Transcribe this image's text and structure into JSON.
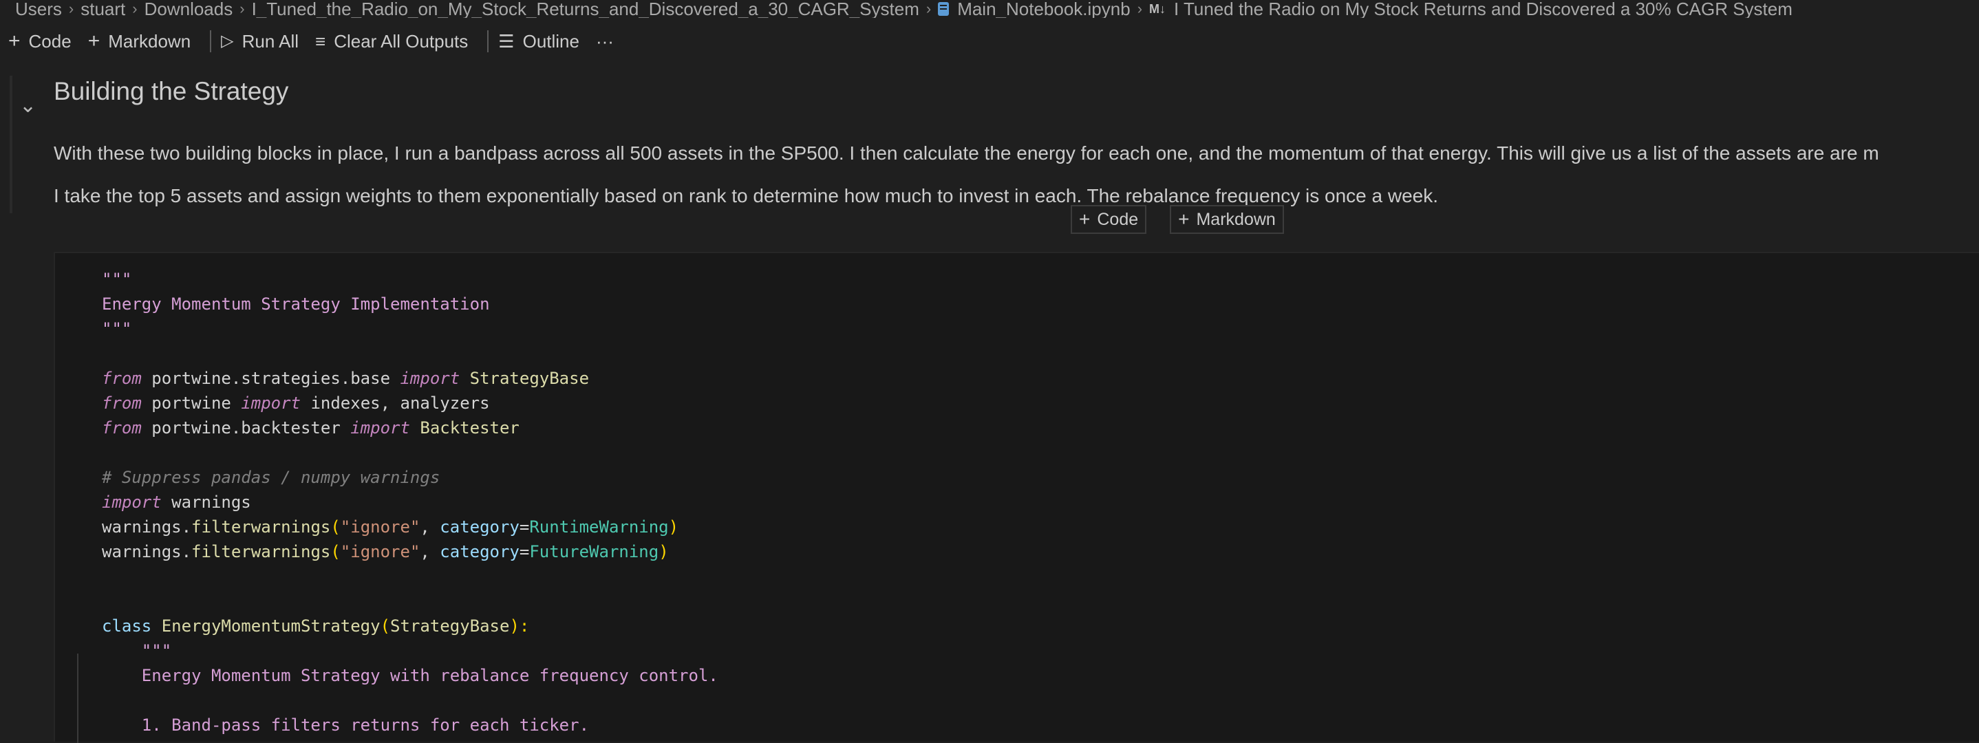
{
  "breadcrumb": {
    "items": [
      "Users",
      "stuart",
      "Downloads",
      "I_Tuned_the_Radio_on_My_Stock_Returns_and_Discovered_a_30_CAGR_System",
      "Main_Notebook.ipynb",
      "I Tuned the Radio on My Stock Returns and Discovered a 30% CAGR System"
    ],
    "md_icon_label": "M↓"
  },
  "toolbar": {
    "code_label": "Code",
    "markdown_label": "Markdown",
    "run_all_label": "Run All",
    "clear_outputs_label": "Clear All Outputs",
    "outline_label": "Outline",
    "more_label": "···"
  },
  "markdown_cell": {
    "heading": "Building the Strategy",
    "para1": "With these two building blocks in place, I run a bandpass across all 500 assets in the SP500. I then calculate the energy for each one, and the momentum of that energy. This will give us a list of the assets are are m",
    "para2": "I take the top 5 assets and assign weights to them exponentially based on rank to determine how much to invest in each. The rebalance frequency is once a week."
  },
  "insert": {
    "code_label": "Code",
    "markdown_label": "Markdown"
  },
  "code_cell": {
    "lines": {
      "l1": "\"\"\"",
      "l2": "Energy Momentum Strategy Implementation",
      "l3": "\"\"\"",
      "l5_kw": "from",
      "l5_mod": " portwine.strategies.base ",
      "l5_imp": "import",
      "l5_name": " StrategyBase",
      "l6_kw": "from",
      "l6_mod": " portwine ",
      "l6_imp": "import",
      "l6_name": " indexes, analyzers",
      "l7_kw": "from",
      "l7_mod": " portwine.backtester ",
      "l7_imp": "import",
      "l7_name": " Backtester",
      "l9": "# Suppress pandas / numpy warnings",
      "l10_kw": "import",
      "l10_name": " warnings",
      "l11_a": "warnings.",
      "l11_fn": "filterwarnings",
      "l11_p1": "(",
      "l11_s": "\"ignore\"",
      "l11_c": ", ",
      "l11_param": "category",
      "l11_eq": "=",
      "l11_ty": "RuntimeWarning",
      "l11_p2": ")",
      "l12_a": "warnings.",
      "l12_fn": "filterwarnings",
      "l12_p1": "(",
      "l12_s": "\"ignore\"",
      "l12_c": ", ",
      "l12_param": "category",
      "l12_eq": "=",
      "l12_ty": "FutureWarning",
      "l12_p2": ")",
      "l15_kw": "class",
      "l15_name": " EnergyMomentumStrategy",
      "l15_p1": "(",
      "l15_base": "StrategyBase",
      "l15_p2": "):",
      "l16": "    \"\"\"",
      "l17": "    Energy Momentum Strategy with rebalance frequency control.",
      "l19": "    1. Band-pass filters returns for each ticker."
    }
  },
  "colors": {
    "background": "#1f1f1f",
    "code_background": "#181818",
    "string": "#ce9178",
    "docstring": "#d69fd6",
    "keyword": "#c586c0",
    "type": "#4ec9b0",
    "function": "#dcdcaa",
    "comment": "#7f7f7f"
  }
}
